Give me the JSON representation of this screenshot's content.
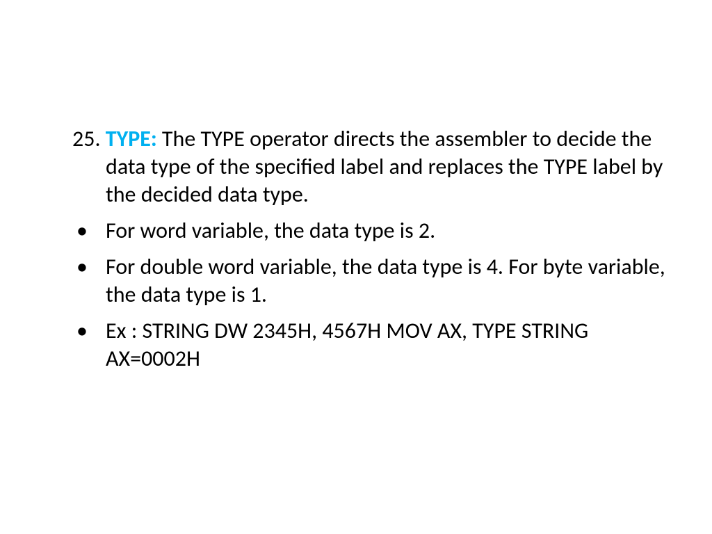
{
  "slide": {
    "number": "25.",
    "keyword": "TYPE:",
    "description": "The TYPE operator directs the assembler to decide the data type of the specified label and replaces the TYPE label by the decided data type.",
    "bullets": [
      "For word variable, the data type is 2.",
      "For double word variable, the data type is 4. For byte variable, the data type is 1.",
      "Ex : STRING DW 2345H, 4567H MOV AX, TYPE STRING AX=0002H"
    ]
  }
}
